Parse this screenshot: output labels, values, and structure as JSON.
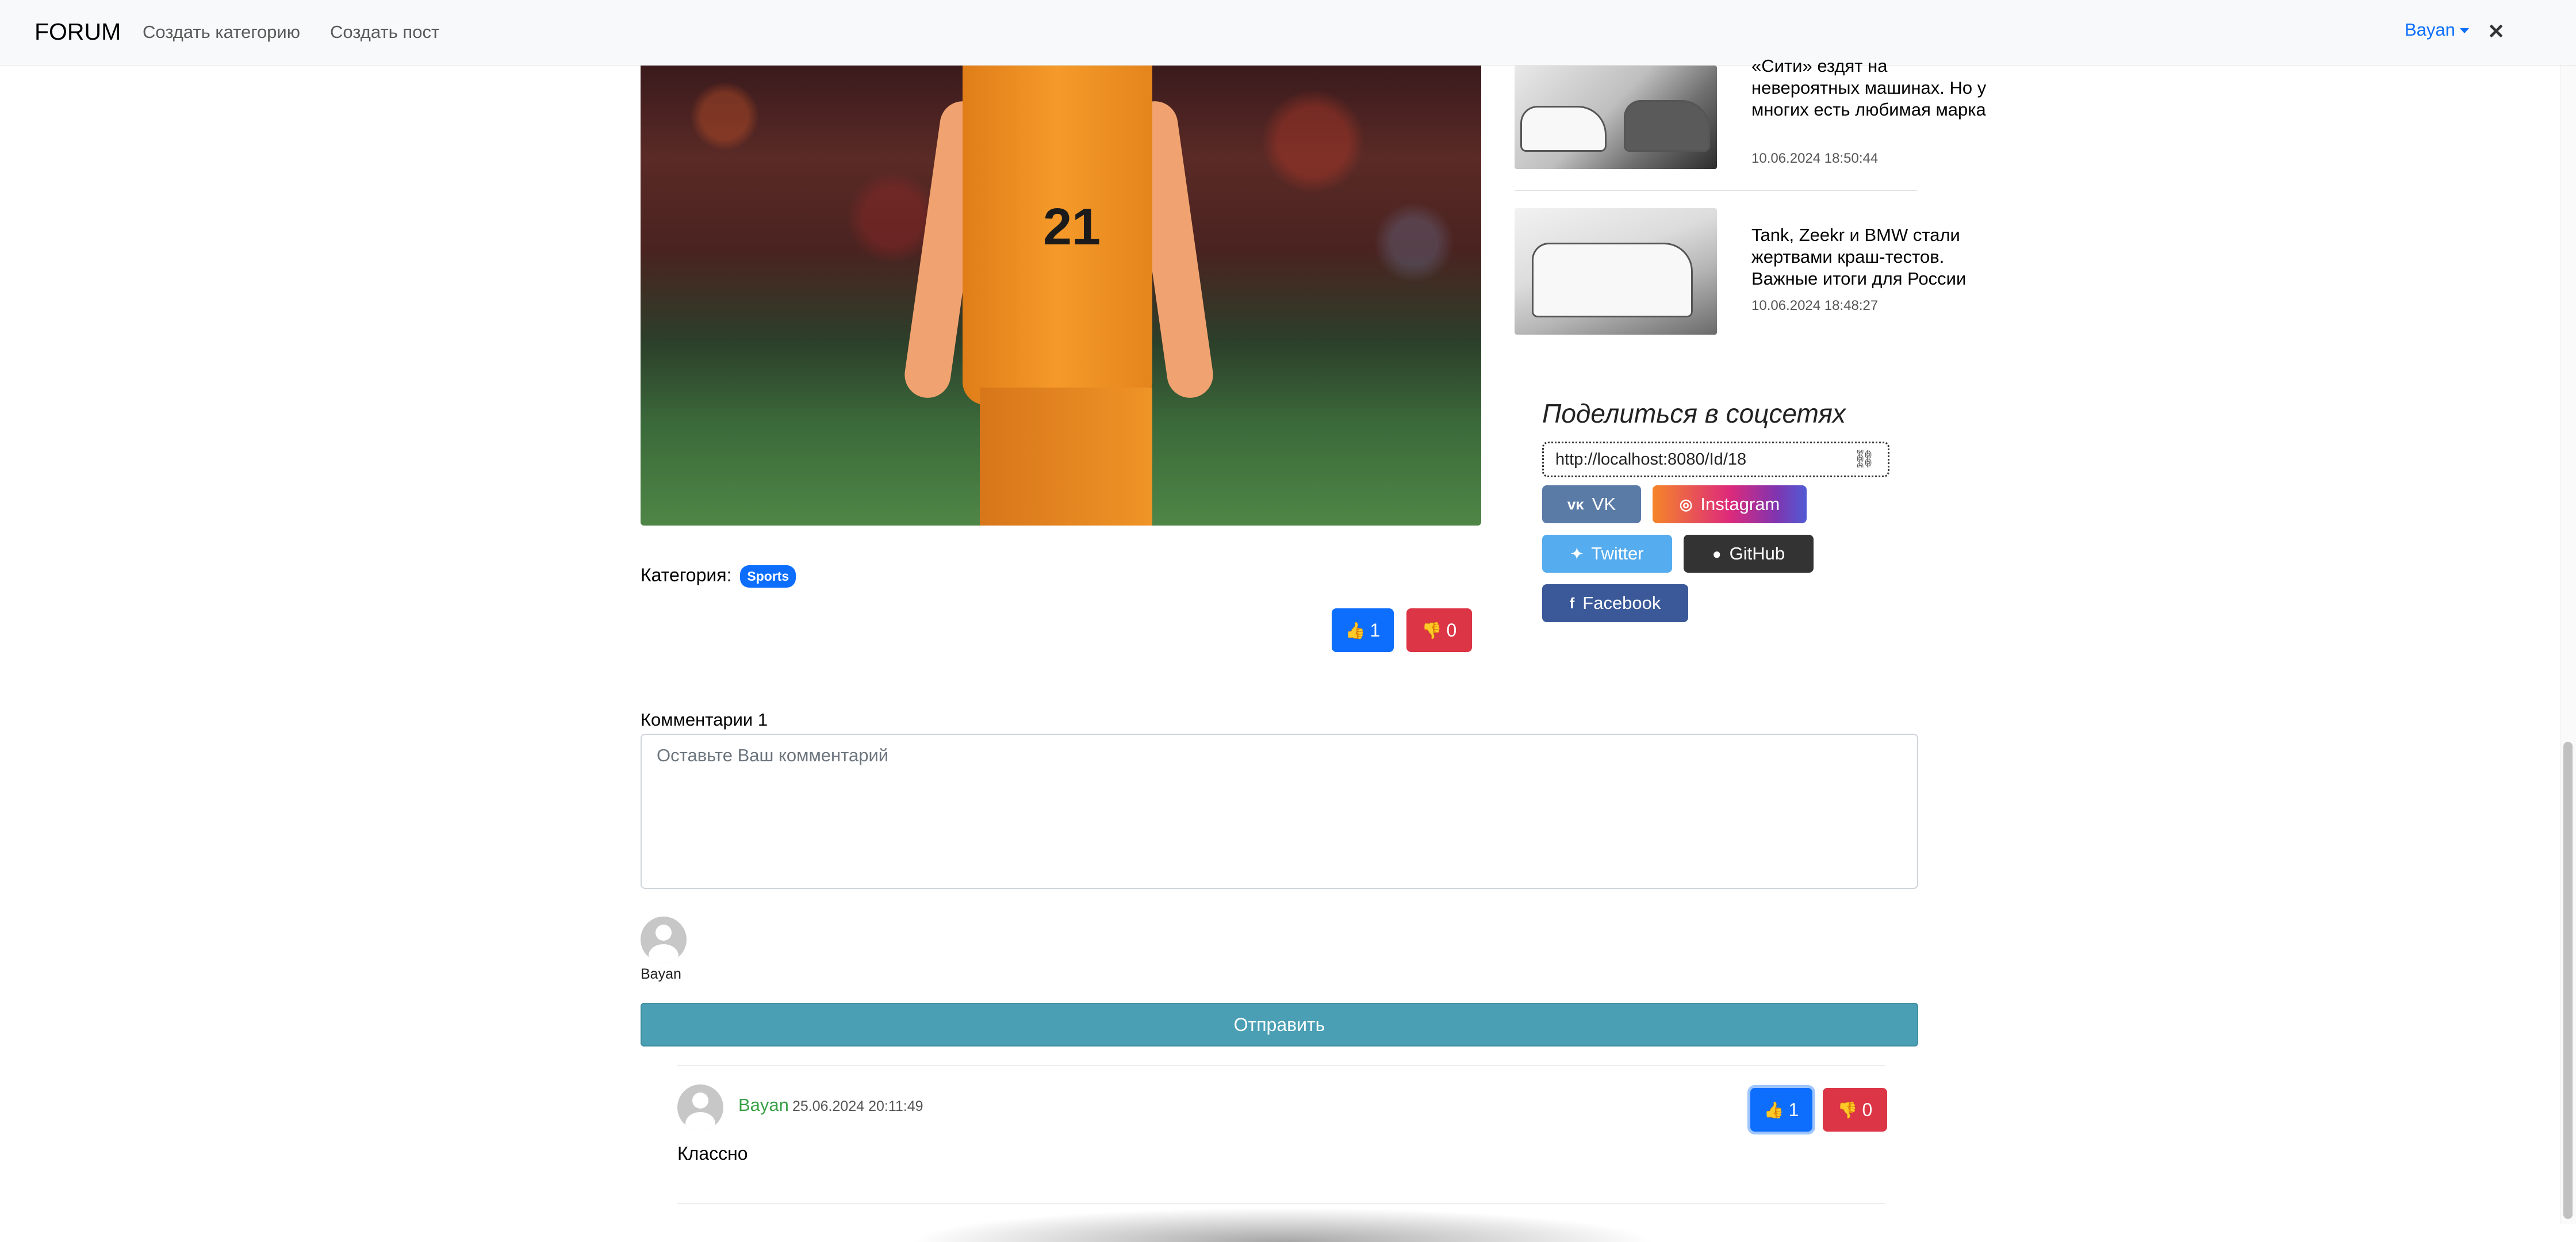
{
  "navbar": {
    "brand": "FORUM",
    "links": [
      "Создать категорию",
      "Создать пост"
    ],
    "user": "Bayan",
    "close": "✕"
  },
  "article": {
    "image_alt": "football player in orange kit",
    "jersey_number": "21",
    "category_label": "Категория:",
    "category": "Sports",
    "likes": "1",
    "dislikes": "0"
  },
  "sidebar": {
    "news": [
      {
        "title": "«Сити» ездят на невероятных машинах. Но у многих есть любимая марка",
        "date": "10.06.2024 18:50:44"
      },
      {
        "title": "Tank, Zeekr и BMW стали жертвами краш-тестов. Важные итоги для России",
        "date": "10.06.2024 18:48:27"
      }
    ]
  },
  "share": {
    "title": "Поделиться в соцсетях",
    "url": "http://localhost:8080/Id/18",
    "buttons": {
      "vk": "VK",
      "instagram": "Instagram",
      "twitter": "Twitter",
      "github": "GitHub",
      "facebook": "Facebook"
    }
  },
  "comments": {
    "heading": "Комментарии 1",
    "placeholder": "Оставьте Ваш комментарий",
    "current_user": "Bayan",
    "submit": "Отправить",
    "items": [
      {
        "author": "Bayan",
        "date": "25.06.2024 20:11:49",
        "text": "Классно",
        "likes": "1",
        "dislikes": "0"
      }
    ]
  },
  "colors": {
    "primary": "#0d6efd",
    "danger": "#dc3545",
    "submit": "#4a9fb5",
    "author": "#38a146"
  }
}
